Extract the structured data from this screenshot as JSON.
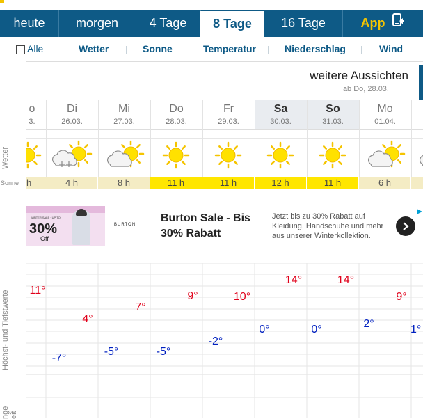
{
  "tabs": [
    {
      "label": "heute"
    },
    {
      "label": "morgen"
    },
    {
      "label": "4 Tage"
    },
    {
      "label": "8 Tage"
    },
    {
      "label": "16 Tage"
    },
    {
      "label": "App"
    }
  ],
  "filters": {
    "all": "Alle",
    "items": [
      "Wetter",
      "Sonne",
      "Temperatur",
      "Niederschlag",
      "Wind"
    ]
  },
  "outlook": {
    "title": "weitere Aussichten",
    "subtitle": "ab Do, 28.03."
  },
  "row_labels": {
    "weather": "Wetter",
    "sun": "Sonne",
    "temps": "Höchst- und Tiefstwerte",
    "precip": "nge",
    "precip2": "eit"
  },
  "days": [
    {
      "name": "o",
      "date": "3."
    },
    {
      "name": "Di",
      "date": "26.03."
    },
    {
      "name": "Mi",
      "date": "27.03."
    },
    {
      "name": "Do",
      "date": "28.03."
    },
    {
      "name": "Fr",
      "date": "29.03."
    },
    {
      "name": "Sa",
      "date": "30.03."
    },
    {
      "name": "So",
      "date": "31.03."
    },
    {
      "name": "Mo",
      "date": "01.04."
    }
  ],
  "weather_icons": [
    "sun-icon",
    "snow-cloud-sun-icon",
    "cloud-sun-icon",
    "sun-icon",
    "sun-icon",
    "sun-icon",
    "sun-icon",
    "cloud-sun-icon"
  ],
  "sunshine": [
    "h",
    "4 h",
    "8 h",
    "11 h",
    "11 h",
    "12 h",
    "11 h",
    "6 h"
  ],
  "temps": {
    "max": [
      "11°",
      "4°",
      "7°",
      "9°",
      "10°",
      "14°",
      "14°",
      "9°"
    ],
    "min": [
      "-7°",
      "-5°",
      "-5°",
      "-2°",
      "0°",
      "0°",
      "2°",
      "1°"
    ]
  },
  "ad": {
    "headline": "Burton Sale - Bis 30% Rabatt",
    "body": "Jetzt bis zu 30% Rabatt auf Kleidung, Handschuhe und mehr aus unserer Winterkollektion.",
    "brand": "BURTON",
    "promo_big": "30%",
    "promo_off": "Off",
    "promo_small": "WINTER SALE · UP TO"
  },
  "colors": {
    "tab_bar": "#0e5a86",
    "accent_yellow": "#ffe600",
    "max_temp": "#e0001a",
    "min_temp": "#0020c0"
  }
}
